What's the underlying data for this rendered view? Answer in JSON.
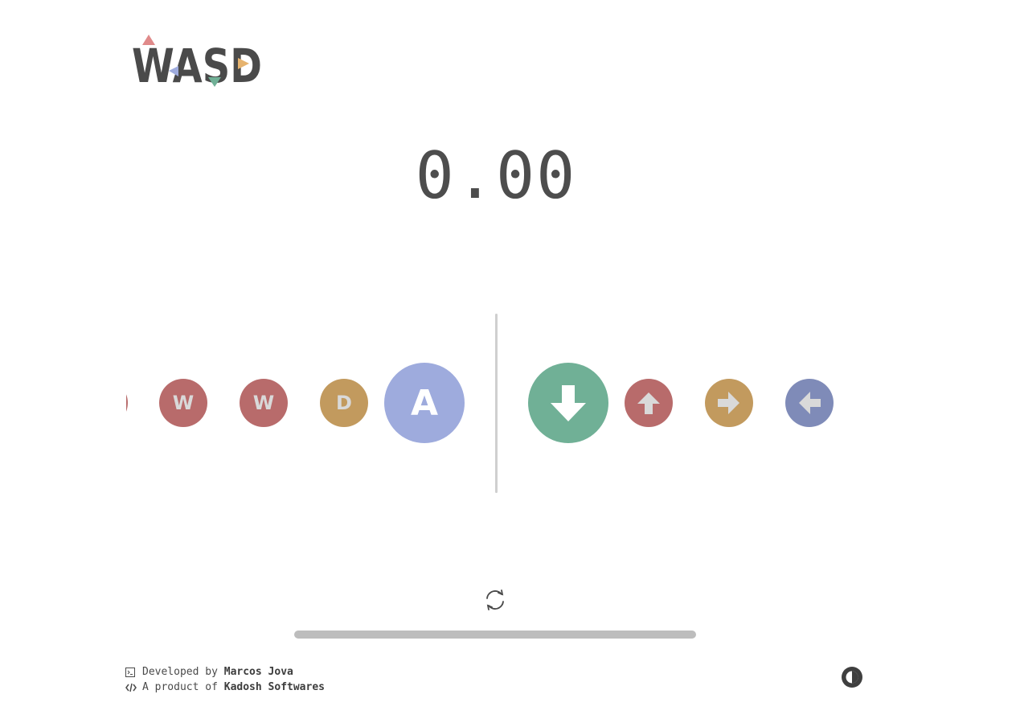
{
  "app": {
    "logo_text": "WASD"
  },
  "timer": {
    "value": "0.00"
  },
  "history_keys": [
    {
      "label": "W",
      "color": "#b86b6b"
    },
    {
      "label": "W",
      "color": "#b86b6b"
    },
    {
      "label": "D",
      "color": "#c29a5e"
    },
    {
      "label": "A",
      "color": "#9eabdd"
    }
  ],
  "queue_keys": [
    {
      "icon": "arrow-down-icon",
      "color": "#70b096"
    },
    {
      "icon": "arrow-up-icon",
      "color": "#b86b6b"
    },
    {
      "icon": "arrow-right-icon",
      "color": "#c29a5e"
    },
    {
      "icon": "arrow-left-icon",
      "color": "#7f8bb8"
    }
  ],
  "controls": {
    "restart_icon": "restart-icon",
    "progress": 1.0
  },
  "footer": {
    "dev_prefix": "Developed by ",
    "dev_name": "Marcos Jova",
    "product_prefix": "A product of ",
    "product_name": "Kadosh Softwares",
    "theme_icon": "contrast-icon"
  }
}
